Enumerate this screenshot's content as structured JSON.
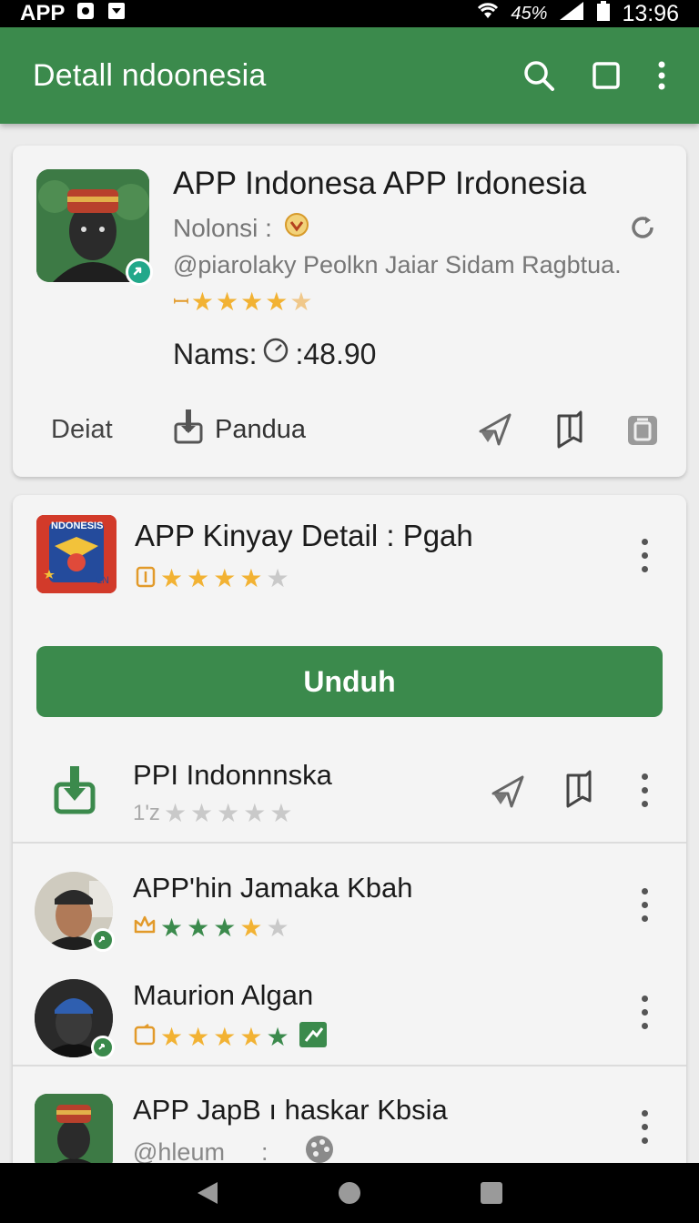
{
  "status_bar": {
    "left_label": "APP",
    "battery_pct": "45%",
    "time": "13:96"
  },
  "app_bar": {
    "title": "Detall ndoonesia",
    "icons": [
      "search-icon",
      "square-icon",
      "more-vert-icon"
    ]
  },
  "featured": {
    "title": "APP  Indonesa APP Irdonesia",
    "subtitle": "Nolonsi :",
    "developer": "@piarolaky Peolkn Jaiar Sidam Ragbtua.",
    "rating_stars": 4,
    "price_label": "Nams:",
    "price_value": ":48.90",
    "details_label": "Deiat",
    "guide_label": "Pandua",
    "colors": {
      "accent": "#3b8a4c",
      "star": "#f2b233",
      "badge": "#22a88a"
    }
  },
  "list": {
    "top_item": {
      "title": "APP Kinyay Detail : Pgah",
      "logo_text": "NDONESIS",
      "logo_corner": "LN",
      "rating_stars": 4
    },
    "download_label": "Unduh",
    "items": [
      {
        "title": "PPI Indonnnska",
        "stars_prefix": "1'z",
        "rating_stars": 0
      },
      {
        "title": "APP'hin Jamaka Kbah",
        "rating_stars": 4
      },
      {
        "title": "Maurion Algan",
        "rating_stars": 5
      },
      {
        "title": "APP JapB ı haskar Kbsia",
        "subtitle": "@hleum",
        "separator": ":"
      }
    ]
  },
  "nav_bar": {
    "icons": [
      "back-icon",
      "home-icon",
      "recents-icon"
    ]
  }
}
